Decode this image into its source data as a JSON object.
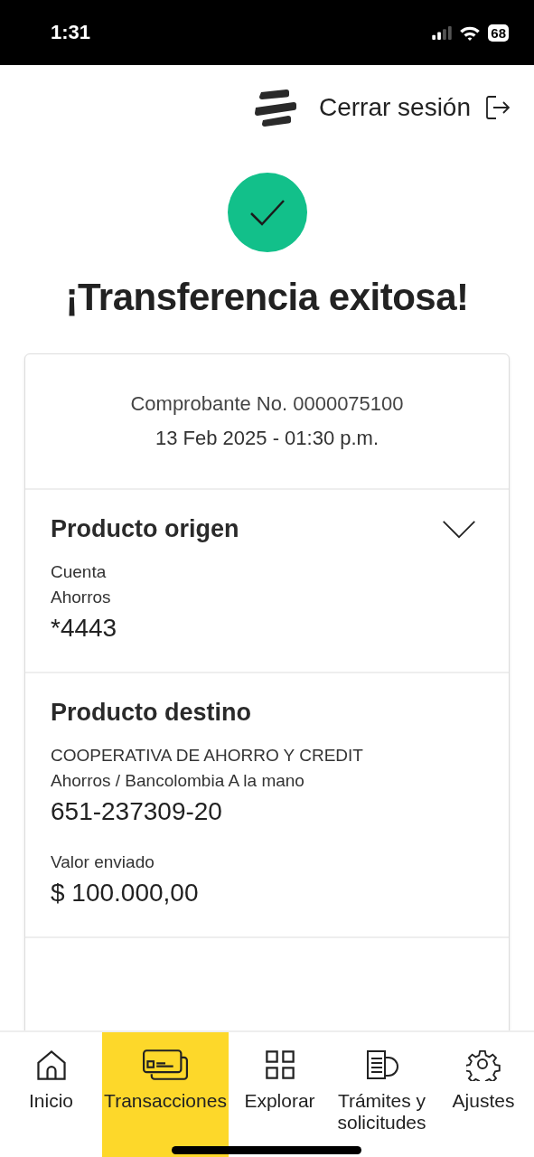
{
  "status_bar": {
    "time": "1:31",
    "battery": "68"
  },
  "header": {
    "logout": "Cerrar sesión"
  },
  "result": {
    "title": "¡Transferencia exitosa!",
    "success": true
  },
  "receipt": {
    "number": "Comprobante No. 0000075100",
    "date": "13 Feb 2025 - 01:30 p.m."
  },
  "sections": [
    {
      "title": "Producto origen",
      "expandable": true,
      "groups": [
        [
          {
            "kind": "label",
            "text": "Cuenta"
          },
          {
            "kind": "label",
            "text": "Ahorros"
          },
          {
            "kind": "value",
            "text": "*4443"
          }
        ]
      ]
    },
    {
      "title": "Producto destino",
      "expandable": false,
      "groups": [
        [
          {
            "kind": "label",
            "text": "COOPERATIVA DE AHORRO Y CREDIT"
          },
          {
            "kind": "label",
            "text": "Ahorros / Bancolombia A la mano"
          },
          {
            "kind": "value",
            "text": "651-237309-20"
          }
        ],
        [
          {
            "kind": "label",
            "text": "Valor enviado"
          },
          {
            "kind": "value",
            "text": "$ 100.000,00"
          }
        ]
      ]
    }
  ],
  "nav": [
    {
      "kind": "home",
      "label": "Inicio",
      "selected": false
    },
    {
      "kind": "cards",
      "label": "Transacciones",
      "selected": true
    },
    {
      "kind": "grid",
      "label": "Explorar",
      "selected": false
    },
    {
      "kind": "document",
      "label": "Trámites y solicitudes",
      "selected": false
    },
    {
      "kind": "gear",
      "label": "Ajustes",
      "selected": false
    }
  ]
}
